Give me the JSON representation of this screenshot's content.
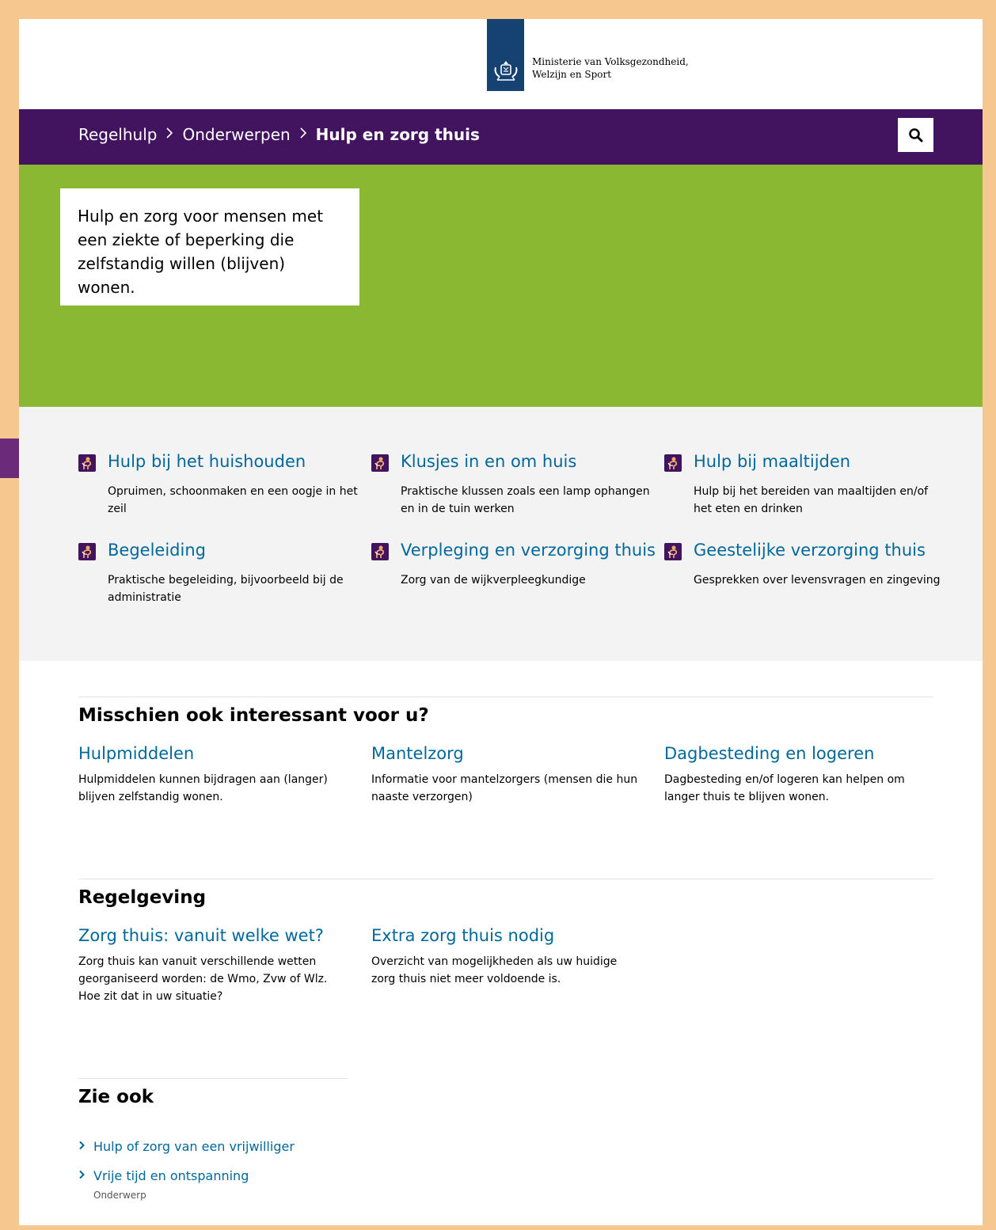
{
  "header": {
    "logo_line1": "Ministerie van Volksgezondheid,",
    "logo_line2": "Welzijn en Sport"
  },
  "breadcrumb": {
    "items": [
      "Regelhulp",
      "Onderwerpen"
    ],
    "current": "Hulp en zorg thuis",
    "separator": ">"
  },
  "hero": {
    "text": "Hulp en zorg voor mensen met een ziekte of beperking die zelfstandig willen (blijven) wonen."
  },
  "topics": [
    {
      "title": "Hulp bij het huishouden",
      "desc": "Opruimen, schoonmaken en een oogje in het zeil"
    },
    {
      "title": "Klusjes in en om huis",
      "desc": "Praktische klussen zoals een lamp ophangen en in de tuin werken"
    },
    {
      "title": "Hulp bij maaltijden",
      "desc": "Hulp bij het bereiden van maaltijden en/of het eten en drinken"
    },
    {
      "title": "Begeleiding",
      "desc": "Praktische begeleiding, bijvoorbeeld bij de administratie"
    },
    {
      "title": "Verpleging en verzorging thuis",
      "desc": "Zorg van de wijkverpleegkundige"
    },
    {
      "title": "Geestelijke verzorging thuis",
      "desc": "Gesprekken over levensvragen en zingeving"
    }
  ],
  "interesting": {
    "title": "Misschien ook interessant voor u?",
    "cards": [
      {
        "title": "Hulpmiddelen",
        "desc": "Hulpmiddelen kunnen bijdragen aan (langer) blijven zelfstandig wonen."
      },
      {
        "title": "Mantelzorg",
        "desc": "Informatie voor mantelzorgers (mensen die hun naaste verzorgen)"
      },
      {
        "title": "Dagbesteding en logeren",
        "desc": "Dagbesteding en/of logeren kan helpen om langer thuis te blijven wonen."
      }
    ]
  },
  "regelgeving": {
    "title": "Regelgeving",
    "cards": [
      {
        "title": "Zorg thuis: vanuit welke wet?",
        "desc": "Zorg thuis kan vanuit verschillende wetten georganiseerd worden: de Wmo, Zvw of Wlz. Hoe zit dat in uw situatie?"
      },
      {
        "title": "Extra zorg thuis nodig",
        "desc": "Overzicht van mogelijkheden als uw huidige zorg thuis niet meer voldoende is."
      }
    ]
  },
  "zie_ook": {
    "title": "Zie ook",
    "links": [
      {
        "label": "Hulp of zorg van een vrijwilliger",
        "sub": ""
      },
      {
        "label": "Vrije tijd en ontspanning",
        "sub": "Onderwerp"
      }
    ]
  },
  "colors": {
    "nav_purple": "#42145f",
    "hero_green": "#8ab833",
    "link_blue": "#01689b",
    "logo_blue": "#154273",
    "frame_orange": "#f6c88f",
    "arrow_purple": "#6b2a7a"
  },
  "icons": {
    "search": "search-icon",
    "topic": "person-help-icon",
    "chevron": "chevron-right-icon",
    "annotation": "arrow-right-icon"
  }
}
